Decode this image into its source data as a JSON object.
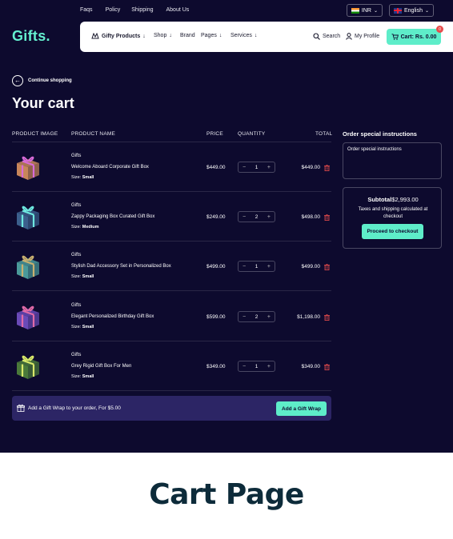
{
  "topbar": {
    "links": [
      "Faqs",
      "Policy",
      "Shipping",
      "About Us"
    ],
    "currency": "INR",
    "language": "English"
  },
  "logo": "Gifts.",
  "nav": {
    "items": [
      "Gifty Products",
      "Shop",
      "Brand",
      "Pages",
      "Services"
    ],
    "search": "Search",
    "profile": "My Profile",
    "cart": "Cart: Rs. 0.00",
    "cart_count": "0"
  },
  "continue_shopping": "Continue shopping",
  "page_title": "Your cart",
  "table": {
    "headers": {
      "image": "PRODUCT IMAGE",
      "name": "PRODUCT NAME",
      "price": "PRICE",
      "quantity": "QUANTITY",
      "total": "TOTAL"
    },
    "rows": [
      {
        "category": "Gifts",
        "name": "Welcome Aboard Corporate Gift Box",
        "size_label": "Size:",
        "size": "Small",
        "price": "$449.00",
        "qty": "1",
        "total": "$449.00",
        "box_color": "#c8865a",
        "ribbon_color": "#d86bd8"
      },
      {
        "category": "Gifts",
        "name": "Zappy Packaging Box Curated Gift Box",
        "size_label": "Size:",
        "size": "Medium",
        "price": "$249.00",
        "qty": "2",
        "total": "$498.00",
        "box_color": "#3b5f8c",
        "ribbon_color": "#6ee8e0"
      },
      {
        "category": "Gifts",
        "name": "Stylish Dad Accessory Set in Personalized Box",
        "size_label": "Size:",
        "size": "Small",
        "price": "$499.00",
        "qty": "1",
        "total": "$499.00",
        "box_color": "#4a9a9a",
        "ribbon_color": "#c8b070"
      },
      {
        "category": "Gifts",
        "name": "Elegant Personalized Birthday Gift Box",
        "size_label": "Size:",
        "size": "Small",
        "price": "$599.00",
        "qty": "2",
        "total": "$1,198.00",
        "box_color": "#6a4ab8",
        "ribbon_color": "#e06aa8"
      },
      {
        "category": "Gifts",
        "name": "Grey Rigid Gift Box For Men",
        "size_label": "Size:",
        "size": "Small",
        "price": "$349.00",
        "qty": "1",
        "total": "$349.00",
        "box_color": "#4a7a3a",
        "ribbon_color": "#d8e86a"
      }
    ]
  },
  "giftwrap": {
    "text": "Add a Gift Wrap to your order, For $5.00",
    "button": "Add a Gift Wrap"
  },
  "sidebar": {
    "instructions_title": "Order special instructions",
    "instructions_placeholder": "Order special instructions",
    "subtotal_label": "Subtotal",
    "subtotal_value": "$2,993.00",
    "tax_note": "Taxes and shipping calculated at checkout",
    "checkout_button": "Proceed to checkout"
  },
  "caption": "Cart Page",
  "colors": {
    "background": "#0d0a2e",
    "accent": "#5eedc9",
    "giftwrap_bar": "#2c2565",
    "danger": "#e74c4c",
    "caption": "#0d2b3a"
  }
}
